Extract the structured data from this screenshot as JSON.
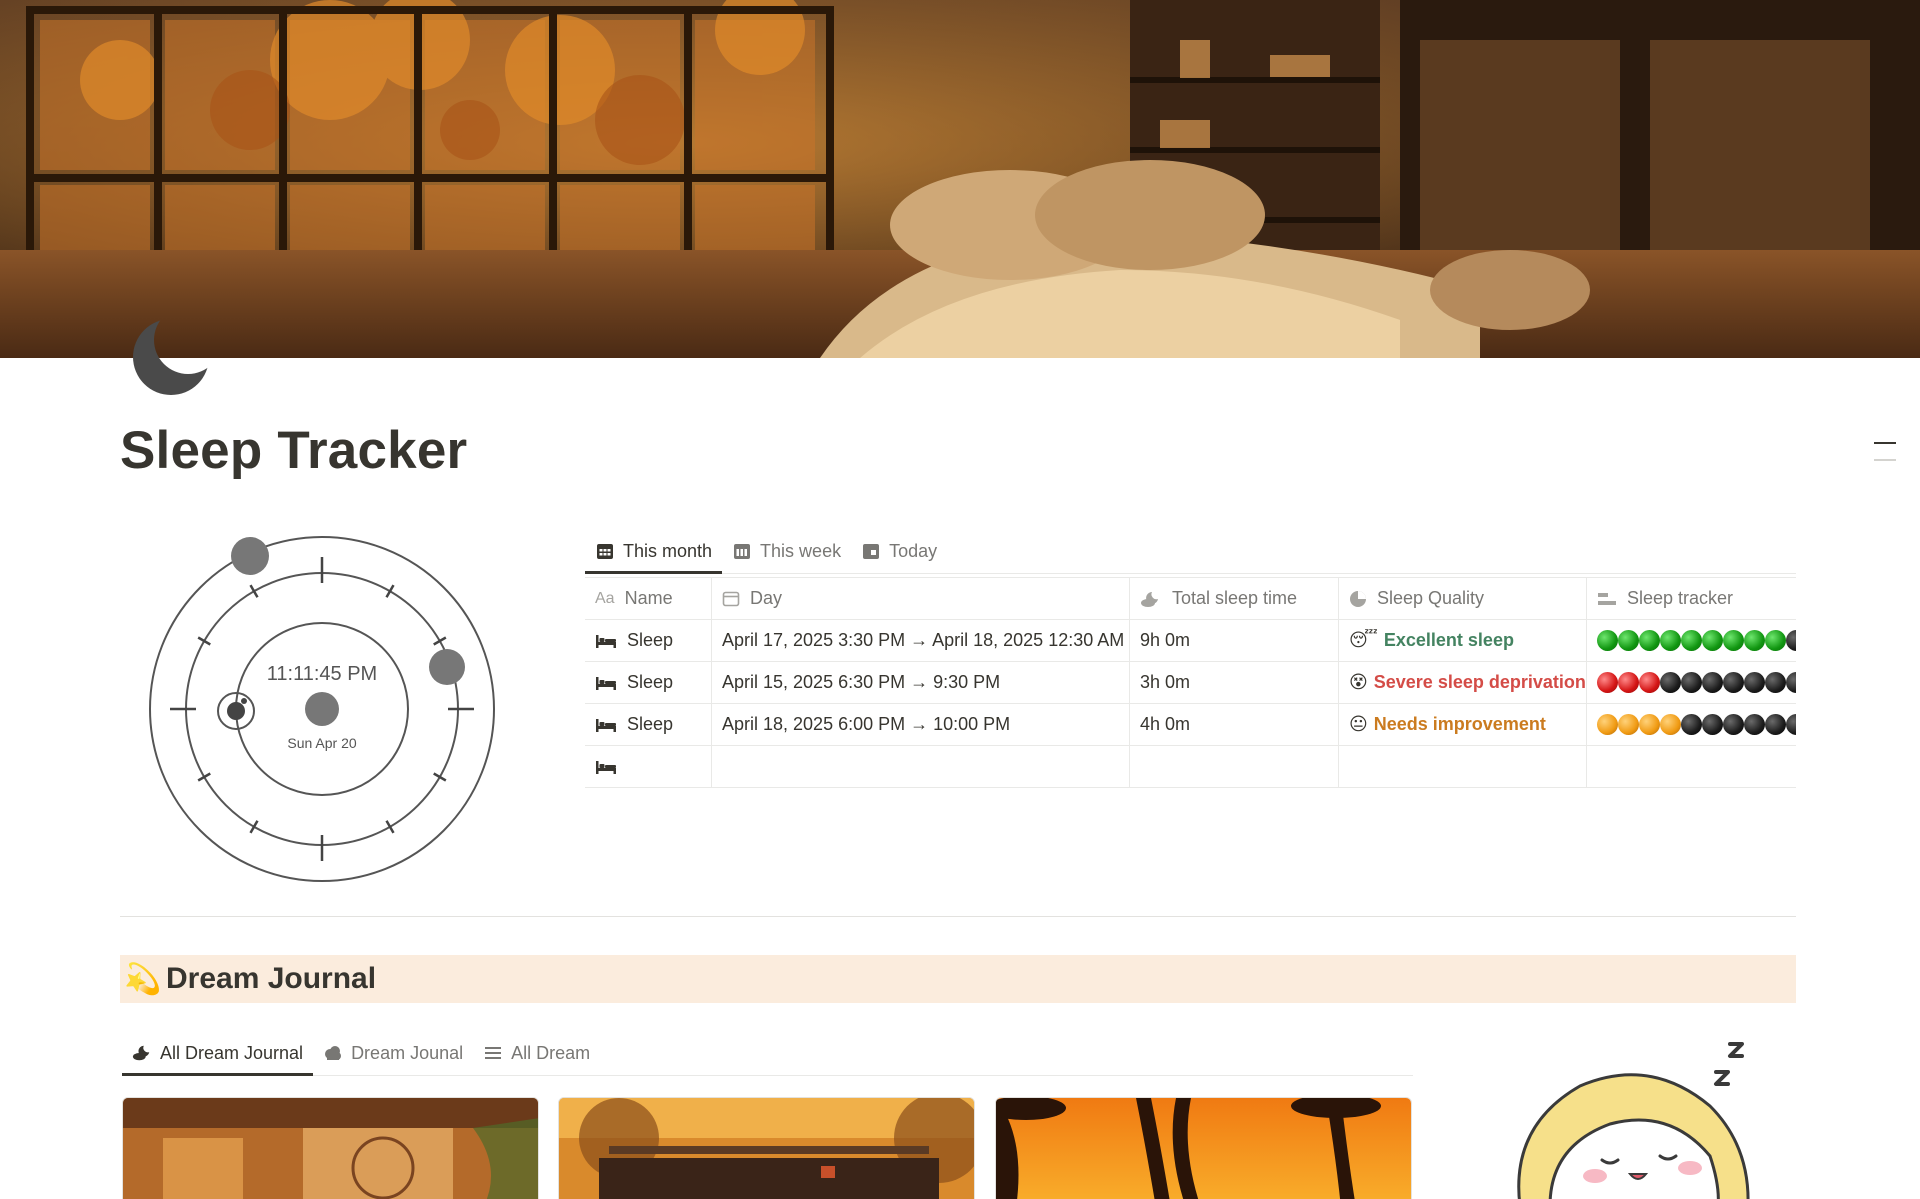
{
  "page": {
    "title": "Sleep Tracker",
    "icon": "crescent-moon-icon"
  },
  "clock": {
    "time": "11:11:45 PM",
    "date": "Sun Apr 20"
  },
  "sleep_views": {
    "tabs": [
      {
        "label": "This month",
        "icon": "calendar-grid-icon",
        "active": true
      },
      {
        "label": "This week",
        "icon": "calendar-week-icon",
        "active": false
      },
      {
        "label": "Today",
        "icon": "calendar-today-icon",
        "active": false
      }
    ]
  },
  "sleep_table": {
    "columns": [
      {
        "label": "Name",
        "icon": "text-aa-icon"
      },
      {
        "label": "Day",
        "icon": "calendar-icon"
      },
      {
        "label": "Total sleep time",
        "icon": "moon-cloud-icon"
      },
      {
        "label": "Sleep Quality",
        "icon": "status-circle-icon"
      },
      {
        "label": "Sleep tracker",
        "icon": "progress-bars-icon"
      }
    ],
    "rows": [
      {
        "name": "Sleep",
        "day": "April 17, 2025 3:30 PM → April 18, 2025 12:30 AM",
        "total": "9h 0m",
        "quality_emoji": "😴",
        "quality": "Excellent sleep",
        "quality_color": "#448361",
        "tracker": [
          "green",
          "green",
          "green",
          "green",
          "green",
          "green",
          "green",
          "green",
          "green",
          "black"
        ]
      },
      {
        "name": "Sleep",
        "day": "April 15, 2025 6:30 PM → 9:30 PM",
        "total": "3h 0m",
        "quality_emoji": "😵",
        "quality": "Severe sleep deprivation",
        "quality_color": "#d44c47",
        "tracker": [
          "red",
          "red",
          "red",
          "black",
          "black",
          "black",
          "black",
          "black",
          "black",
          "black"
        ]
      },
      {
        "name": "Sleep",
        "day": "April 18, 2025 6:00 PM → 10:00 PM",
        "total": "4h 0m",
        "quality_emoji": "😐",
        "quality": "Needs improvement",
        "quality_color": "#cb7b1f",
        "tracker": [
          "orange",
          "orange",
          "orange",
          "orange",
          "black",
          "black",
          "black",
          "black",
          "black",
          "black"
        ]
      }
    ],
    "empty_row_icon": "bed-icon"
  },
  "dream_journal": {
    "emoji": "💫",
    "title": "Dream Journal",
    "tabs": [
      {
        "label": "All Dream Journal",
        "icon": "moon-cloud-icon",
        "active": true
      },
      {
        "label": "Dream Jounal",
        "icon": "cloud-icon",
        "active": false
      },
      {
        "label": "All Dream",
        "icon": "list-icon",
        "active": false
      }
    ]
  }
}
